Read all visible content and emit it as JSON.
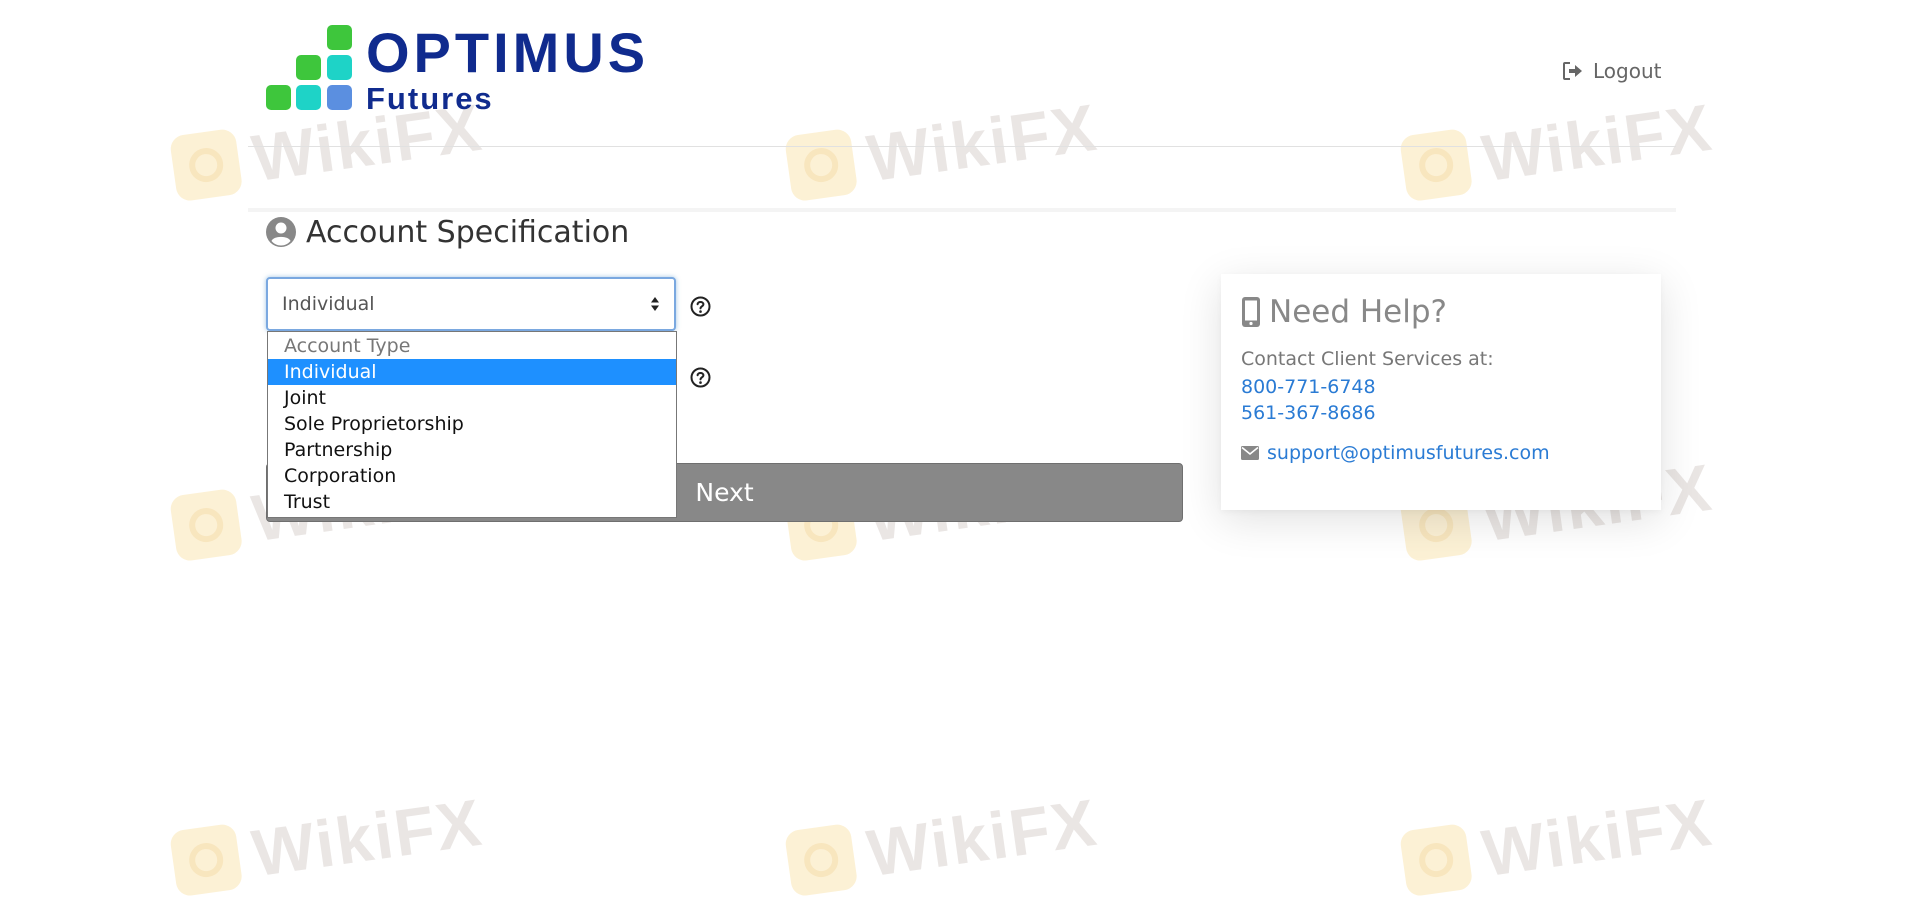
{
  "brand": {
    "title": "OPTIMUS",
    "subtitle": "Futures",
    "colors": {
      "navy": "#102b8e",
      "green": "#3ec63c",
      "teal": "#1ed3c7",
      "blue": "#5b8fe0"
    }
  },
  "header": {
    "logout_label": "Logout",
    "logout_icon": "sign-out-icon"
  },
  "section": {
    "title": "Account Specification",
    "icon": "user-circle-icon"
  },
  "form": {
    "account_type": {
      "value": "Individual",
      "options": [
        "Account Type",
        "Individual",
        "Joint",
        "Sole Proprietorship",
        "Partnership",
        "Corporation",
        "Trust"
      ],
      "selected_index": 1
    },
    "next_label": "Next",
    "help_icon": "question-circle-icon"
  },
  "help": {
    "title": "Need Help?",
    "icon": "mobile-phone-icon",
    "contact_text": "Contact Client Services at:",
    "phone1": "800-771-6748",
    "phone2": "561-367-8686",
    "email": "support@optimusfutures.com",
    "email_icon": "envelope-icon"
  },
  "watermark": {
    "text": "WikiFX"
  }
}
